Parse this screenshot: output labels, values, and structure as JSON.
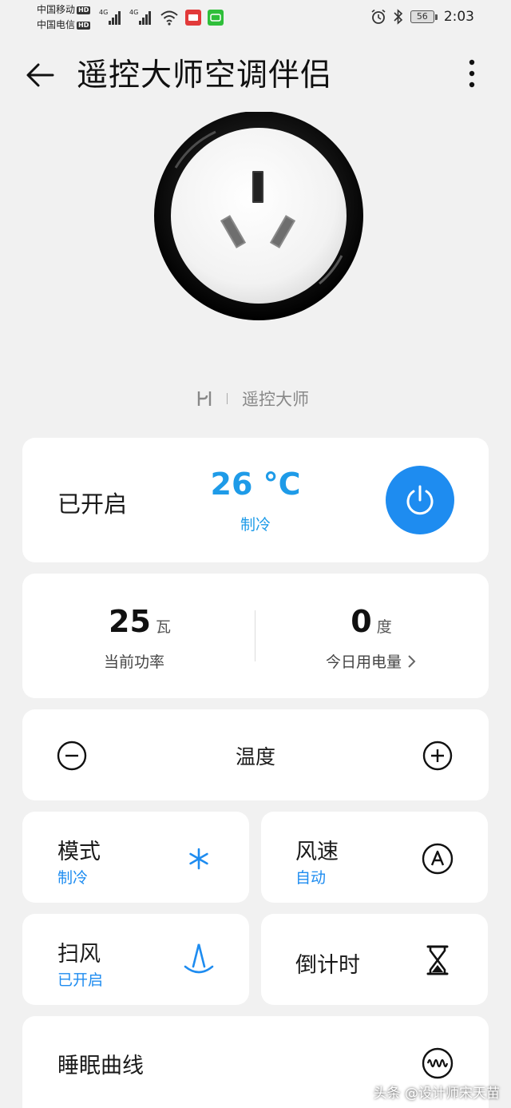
{
  "status_bar": {
    "carrier1": "中国移动",
    "carrier2": "中国电信",
    "hd": "HD",
    "net1": "4G",
    "net2": "4G",
    "battery": "56",
    "time": "2:03"
  },
  "header": {
    "title": "遥控大师空调伴侣"
  },
  "brand": {
    "name": "遥控大师"
  },
  "status_card": {
    "state": "已开启",
    "temperature": "26 °C",
    "mode": "制冷"
  },
  "stats": {
    "power_value": "25",
    "power_unit": "瓦",
    "power_label": "当前功率",
    "energy_value": "0",
    "energy_unit": "度",
    "energy_label": "今日用电量"
  },
  "temperature_row": {
    "label": "温度"
  },
  "tiles": {
    "mode_title": "模式",
    "mode_value": "制冷",
    "fan_title": "风速",
    "fan_value": "自动",
    "swing_title": "扫风",
    "swing_value": "已开启",
    "timer_title": "倒计时",
    "sleep_title": "睡眠曲线"
  },
  "watermark": "头条 @设计师宋天苗",
  "colors": {
    "accent": "#1e8cf0",
    "temp_blue": "#1e9be8",
    "background": "#f1f1f1",
    "card": "#ffffff"
  },
  "icons": {
    "back": "arrow-left-icon",
    "more": "more-vertical-icon",
    "power": "power-icon",
    "minus": "minus-circle-icon",
    "plus": "plus-circle-icon",
    "mode": "snowflake-icon",
    "fan": "auto-a-icon",
    "swing": "swing-icon",
    "timer": "hourglass-icon",
    "sleep": "wave-icon"
  }
}
